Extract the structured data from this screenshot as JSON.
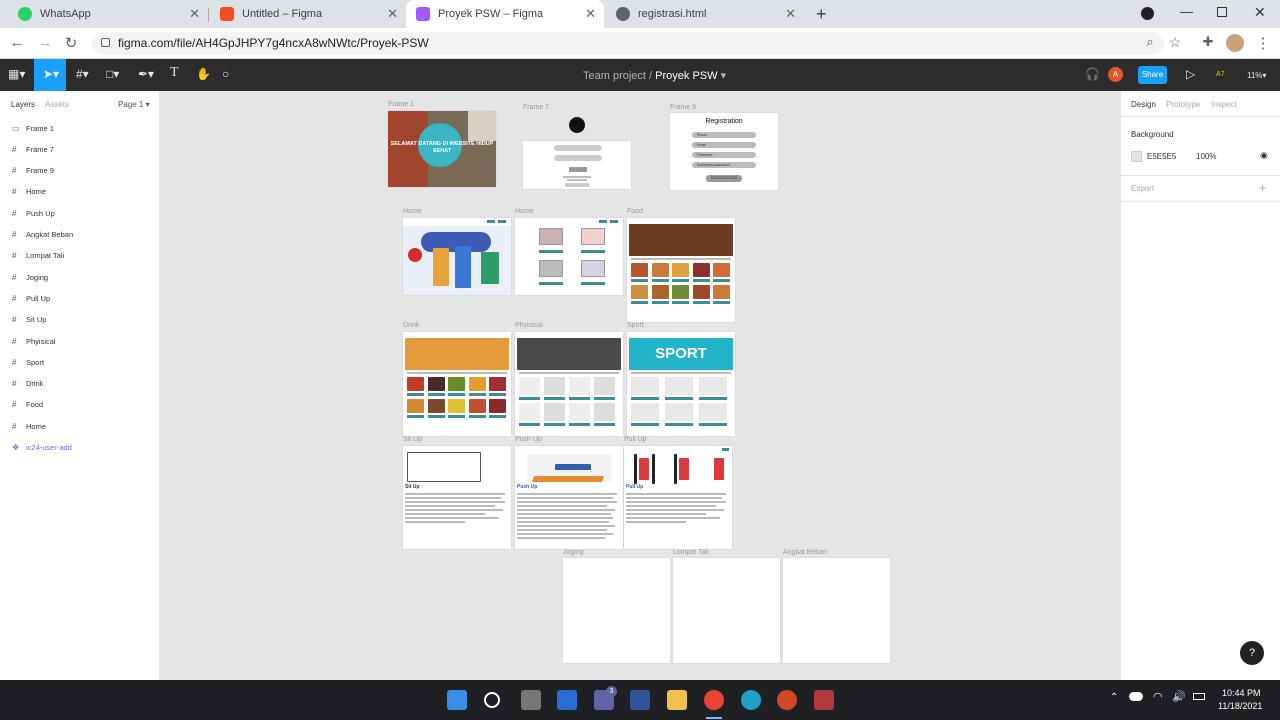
{
  "browser": {
    "tabs": [
      {
        "label": "WhatsApp",
        "color": "#25d366"
      },
      {
        "label": "Untitled – Figma",
        "color": "#f24e1e"
      },
      {
        "label": "Proyek PSW – Figma",
        "color": "#f24e1e"
      },
      {
        "label": "registrasi.html",
        "color": "#5f6368"
      }
    ],
    "url": "figma.com/file/AH4GpJHPY7g4ncxA8wNWtc/Proyek-PSW"
  },
  "figma": {
    "team": "Team project",
    "separator": "/",
    "file": "Proyek PSW",
    "share_label": "Share",
    "zoom": "11%",
    "avatar_letter": "A",
    "a7": "A7"
  },
  "left_panel": {
    "tab_layers": "Layers",
    "tab_assets": "Assets",
    "page": "Page 1",
    "layers": [
      "Frame 1",
      "Frame 7",
      "Frame 9",
      "Home",
      "Push Up",
      "Angkat Beban",
      "Lompat Tali",
      "Joging",
      "Pull Up",
      "Sit Up",
      "Phyisical",
      "Sport",
      "Drink",
      "Food",
      "Home",
      "ic24-user-add"
    ]
  },
  "right_panel": {
    "tab_design": "Design",
    "tab_prototype": "Prototype",
    "tab_inspect": "Inspect",
    "background_label": "Background",
    "bg_hex": "E5E5E5",
    "bg_opacity": "100%",
    "export_label": "Export",
    "accent": "#18a0fb"
  },
  "canvas": {
    "frame_labels": {
      "frame1": "Frame 1",
      "frame7": "Frame 7",
      "frame9": "Frame 9",
      "home1": "Home",
      "home2": "Home",
      "food": "Food",
      "drink": "Drink",
      "physical": "Phyisical",
      "sport": "Sport",
      "situp": "Sit Up",
      "pushup": "Push Up",
      "pullup": "Pull Up",
      "joging": "Joging",
      "lompat": "Lompat Tali",
      "angkat": "Angkat Beban"
    },
    "frame1_text": "SELAMAT DATANG DI WEBSITE HIDUP SEHAT",
    "registration_title": "Registration",
    "registration_fields": [
      "Phone",
      "Email",
      "Password",
      "Konfirmasi password"
    ],
    "registration_button": "REGISTRATION",
    "sport_banner": "SPORT",
    "situp_heading": "Sit Up",
    "pushup_heading": "Push Up",
    "pullup_heading": "Pull Up"
  },
  "taskbar": {
    "time": "10:44 PM",
    "date": "11/18/2021",
    "badge": "3"
  }
}
